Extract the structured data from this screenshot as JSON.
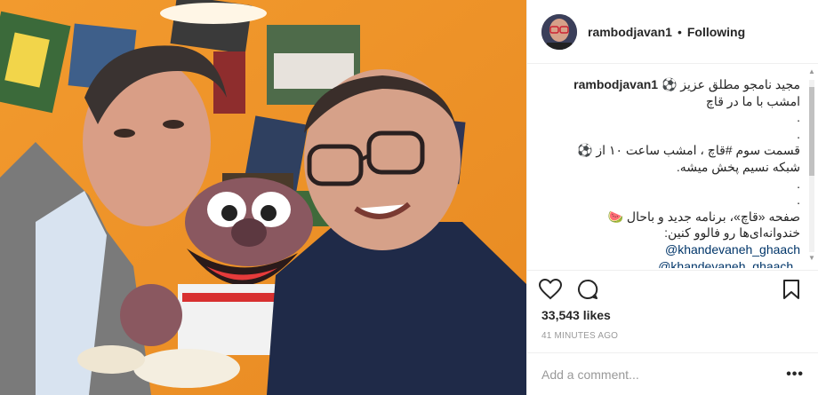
{
  "post": {
    "username": "rambodjavan1",
    "separator": "•",
    "follow_status": "Following",
    "caption_lines": [
      "مجید نامجو مطلق عزیز ⚽",
      "امشب با ما در قاچ",
      ".",
      ".",
      "قسمت سوم #قاچ ، امشب ساعت ۱۰ از ⚽",
      "شبکه نسیم پخش میشه.",
      ".",
      ".",
      "صفحه «قاچ»، برنامه جدید و باحال 🍉",
      "خندوانه‌ای‌ها رو فالوو کنین:"
    ],
    "mentions": [
      "@khandevaneh_ghaach",
      "@khandevaneh_ghaach ."
    ],
    "likes": "33,543 likes",
    "timestamp": "41 MINUTES AGO",
    "comment_placeholder": "Add a comment...",
    "more_label": "•••"
  },
  "icons": {
    "like": "heart-icon",
    "comment": "comment-bubble-icon",
    "save": "bookmark-icon",
    "more": "more-options-icon"
  },
  "colors": {
    "link": "#003569",
    "text": "#262626",
    "muted": "#999999",
    "border": "#efefef",
    "wall": "#f0a23a"
  }
}
